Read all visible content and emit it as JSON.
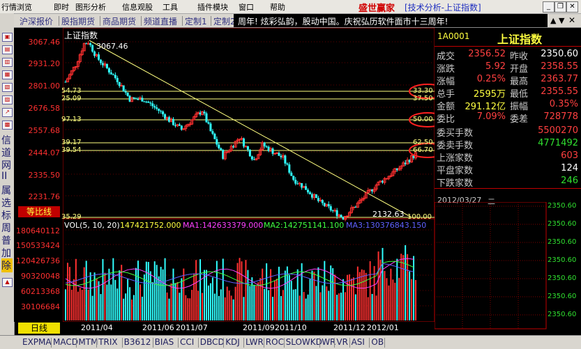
{
  "menu": {
    "items": [
      "行情浏览",
      "即时",
      "图形分析",
      "信息观股",
      "工具",
      "插件模块",
      "窗口",
      "帮助"
    ],
    "title_brand": "盛世赢家",
    "title_sub": "[技术分析-上证指数]"
  },
  "tabs": [
    "沪深报价",
    "股指期货",
    "商品期货",
    "频道直播",
    "定制1",
    "定制2"
  ],
  "ticker_text": "周年! 炫彩弘韵，股动中国。庆祝弘历软件面市十三周年!",
  "sidebar": {
    "chars": [
      "信",
      "道",
      "网",
      "II",
      "属",
      "选",
      "标",
      "周",
      "普",
      "加",
      "除"
    ]
  },
  "chart": {
    "name": "上证指数",
    "price_ticks": [
      "3067.46",
      "2931.20",
      "2801.00",
      "2676.58",
      "2557.68",
      "2444.07",
      "2335.50",
      "2231.76"
    ],
    "equal_ratio_label": "等比线",
    "vol_ticks": [
      "180640112",
      "150533424",
      "120426736",
      "90320048",
      "60213368",
      "30106684"
    ],
    "period_label": "日线",
    "x_labels": [
      "2011/04",
      "2011/06",
      "2011/07",
      "2011/09",
      "2011/10",
      "2011/12",
      "2012/01"
    ],
    "high_label": "3067.46",
    "low_label": "2132.63",
    "fib_left": [
      "54.73",
      "25.09",
      "97.13",
      "39.17",
      "39.54",
      "35.29"
    ],
    "fib_right": [
      "33.30",
      "37.50",
      "50.00",
      "62.50",
      "66.70",
      "100.00"
    ],
    "vol_legend": {
      "vol": "VOL(5, 10, 20)",
      "vol_val": "147421752.000",
      "ma1": "MA1:142633379.000",
      "ma2": "MA2:142751141.100",
      "ma3": "MA3:130376843.150"
    },
    "colors": {
      "up": "#ff3030",
      "down": "#30ffff",
      "fib": "#ffff80",
      "ma1": "#ff40ff",
      "ma2": "#40ff40",
      "ma3": "#6060ff"
    }
  },
  "chart_data": {
    "type": "candlestick",
    "title": "上证指数",
    "ylim": [
      2132.63,
      3067.46
    ],
    "x": [
      "2011/04",
      "2011/06",
      "2011/07",
      "2011/09",
      "2011/10",
      "2011/12",
      "2012/01"
    ],
    "high": 3067.46,
    "low": 2132.63,
    "fib_levels_pct": [
      33.3,
      37.5,
      50.0,
      62.5,
      66.7,
      100.0
    ],
    "volume_ylim": [
      0,
      180640112
    ]
  },
  "quote": {
    "code": "1A0001",
    "name": "上证指数",
    "rows": [
      {
        "l1": "成交",
        "v1": "2356.52",
        "c1": "red",
        "l2": "昨收",
        "v2": "2350.60",
        "c2": "white"
      },
      {
        "l1": "涨跌",
        "v1": "5.92",
        "c1": "red",
        "l2": "开盘",
        "v2": "2358.55",
        "c2": "red"
      },
      {
        "l1": "涨幅",
        "v1": "0.25%",
        "c1": "red",
        "l2": "最高",
        "v2": "2363.77",
        "c2": "red"
      },
      {
        "l1": "总手",
        "v1": "2595万",
        "c1": "yellow",
        "l2": "最低",
        "v2": "2355.55",
        "c2": "red"
      },
      {
        "l1": "金额",
        "v1": "291.12亿",
        "c1": "yellow",
        "l2": "振幅",
        "v2": "0.35%",
        "c2": "red"
      },
      {
        "l1": "委比",
        "v1": "7.09%",
        "c1": "red",
        "l2": "委差",
        "v2": "728778",
        "c2": "red"
      }
    ],
    "singles": [
      {
        "l": "委买手数",
        "v": "5500270",
        "c": "red"
      },
      {
        "l": "委卖手数",
        "v": "4771492",
        "c": "green"
      },
      {
        "l": "上涨家数",
        "v": "603",
        "c": "red"
      },
      {
        "l": "平盘家数",
        "v": "124",
        "c": "white"
      },
      {
        "l": "下跌家数",
        "v": "246",
        "c": "green"
      }
    ],
    "date": "2012/03/27",
    "weekday": "二",
    "mini_ticks": [
      "2350.60",
      "2350.60",
      "2350.60",
      "2350.60",
      "2350.60",
      "2350.60",
      "2350.60"
    ]
  },
  "bottom_tabs": [
    "EXPMA",
    "MACD",
    "MTM",
    "TRIX",
    "B3612",
    "BIAS",
    "CCI",
    "DBCD",
    "KDJ",
    "LWR",
    "ROC",
    "SLOWKD",
    "WR",
    "VR",
    "ASI",
    "OB"
  ]
}
